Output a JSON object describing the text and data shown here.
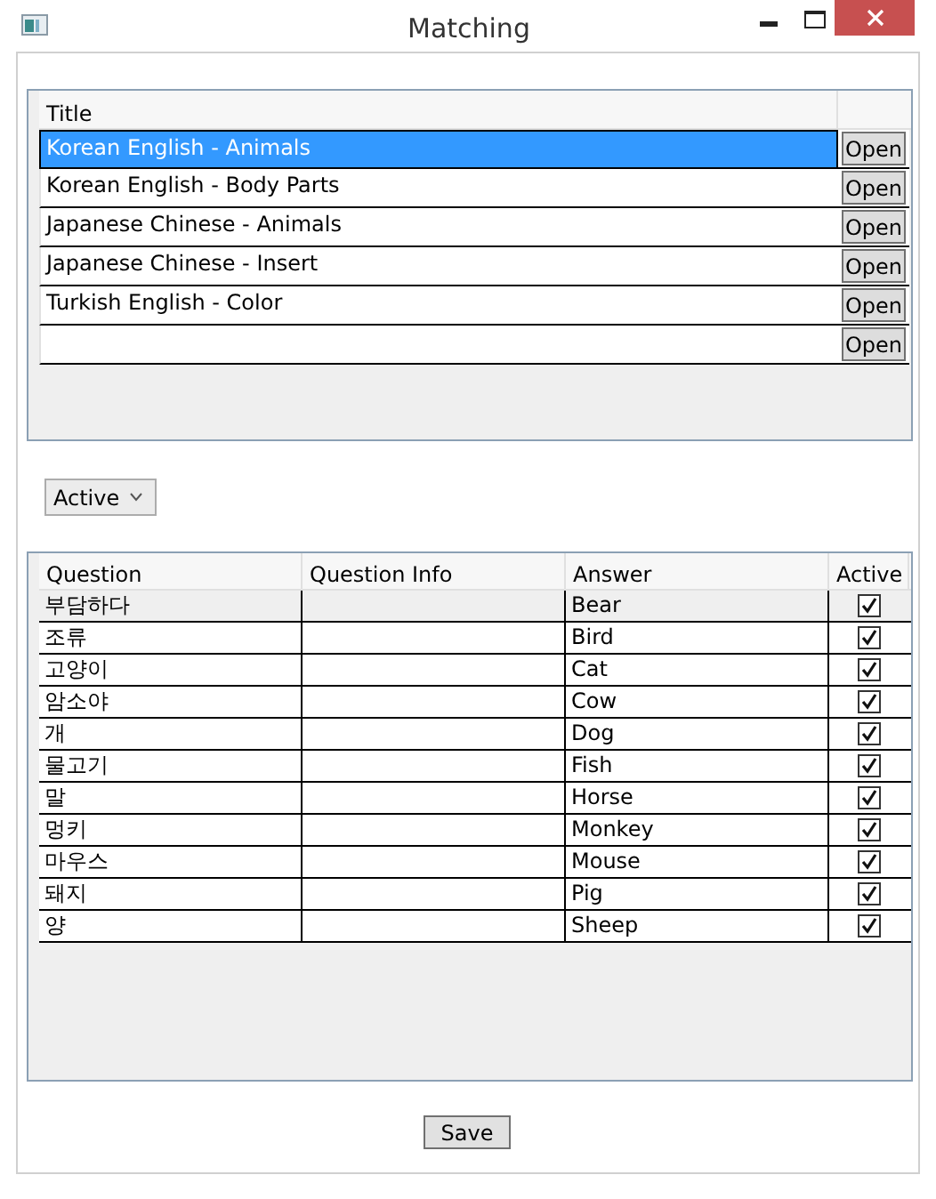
{
  "window": {
    "title": "Matching"
  },
  "sets_table": {
    "columns": [
      "Title"
    ],
    "rows": [
      {
        "kind": "item",
        "title": "Korean English - Animals",
        "button": "Open",
        "selected": true
      },
      {
        "kind": "item",
        "title": "Korean English - Body Parts",
        "button": "Open",
        "selected": false
      },
      {
        "kind": "item",
        "title": "Japanese Chinese - Animals",
        "button": "Open",
        "selected": false
      },
      {
        "kind": "item",
        "title": "Japanese Chinese - Insert",
        "button": "Open",
        "selected": false
      },
      {
        "kind": "item",
        "title": "Turkish English - Color",
        "button": "Open",
        "selected": false
      },
      {
        "kind": "new",
        "button": "Open",
        "selected": false
      }
    ]
  },
  "filter": {
    "value": "Active"
  },
  "items_table": {
    "columns": [
      "Question",
      "Question Info",
      "Answer",
      "Active"
    ],
    "rows": [
      {
        "question": "부담하다",
        "answer": "Bear",
        "active": true,
        "selected": true
      },
      {
        "question": "조류",
        "answer": "Bird",
        "active": true,
        "selected": false
      },
      {
        "question": "고양이",
        "answer": "Cat",
        "active": true,
        "selected": false
      },
      {
        "question": "암소야",
        "answer": "Cow",
        "active": true,
        "selected": false
      },
      {
        "question": "개",
        "answer": "Dog",
        "active": true,
        "selected": false
      },
      {
        "question": "물고기",
        "answer": "Fish",
        "active": true,
        "selected": false
      },
      {
        "question": "말",
        "answer": "Horse",
        "active": true,
        "selected": false
      },
      {
        "question": "멍키",
        "answer": "Monkey",
        "active": true,
        "selected": false
      },
      {
        "question": "마우스",
        "answer": "Mouse",
        "active": true,
        "selected": false
      },
      {
        "question": "돼지",
        "answer": "Pig",
        "active": true,
        "selected": false
      },
      {
        "question": "양",
        "answer": "Sheep",
        "active": true,
        "selected": false
      }
    ]
  },
  "save_button": "Save"
}
